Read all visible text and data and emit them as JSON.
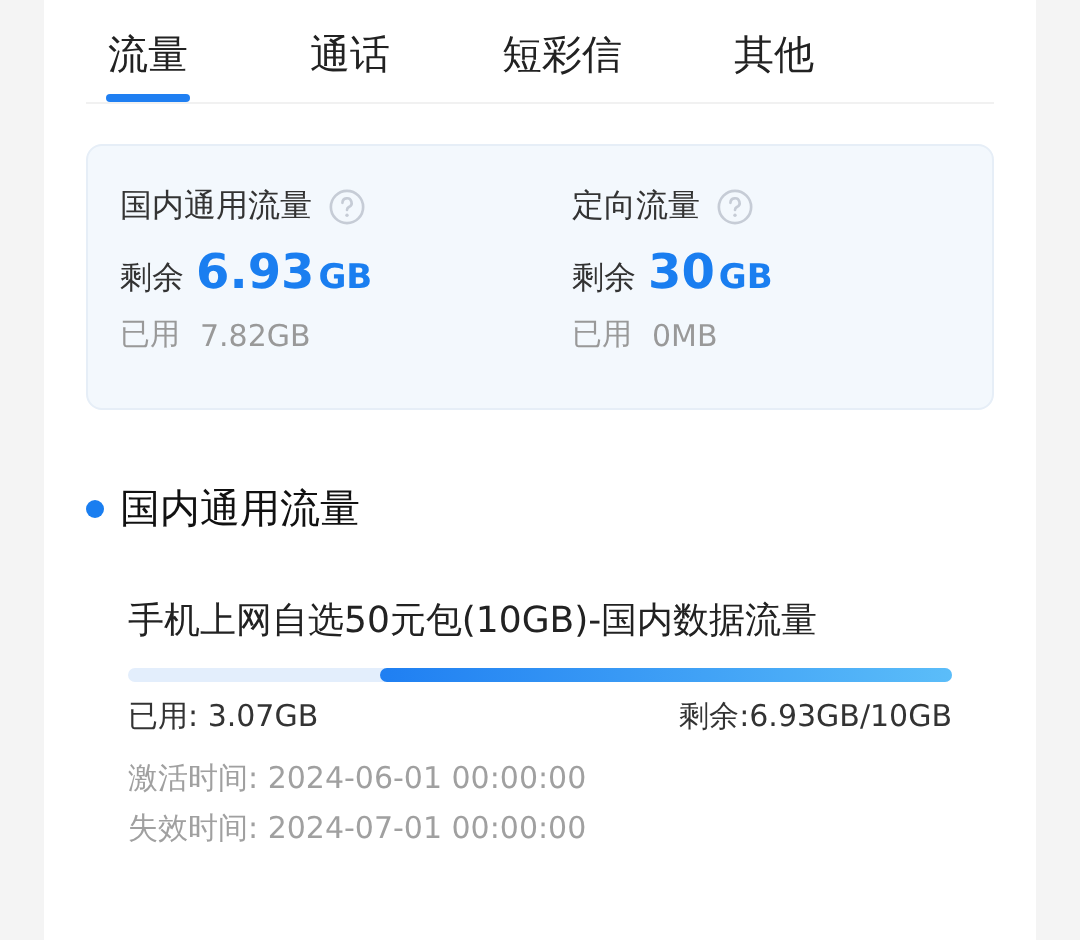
{
  "tabs": [
    {
      "label": "流量",
      "selected": true
    },
    {
      "label": "通话",
      "selected": false
    },
    {
      "label": "短彩信",
      "selected": false
    },
    {
      "label": "其他",
      "selected": false
    }
  ],
  "summary": [
    {
      "title": "国内通用流量",
      "remaining_label": "剩余",
      "remaining_value": "6.93",
      "remaining_unit": "GB",
      "used_label": "已用",
      "used_value": "7.82GB"
    },
    {
      "title": "定向流量",
      "remaining_label": "剩余",
      "remaining_value": "30",
      "remaining_unit": "GB",
      "used_label": "已用",
      "used_value": "0MB"
    }
  ],
  "section": {
    "title": "国内通用流量",
    "packages": [
      {
        "name": "手机上网自选50元包(10GB)-国内数据流量",
        "level": 0.693,
        "used": "已用: 3.07GB",
        "remaining": "剩余:6.93GB/10GB",
        "activated": "激活时间: 2024-06-01 00:00:00",
        "expires": "失效时间: 2024-07-01 00:00:00"
      }
    ]
  }
}
